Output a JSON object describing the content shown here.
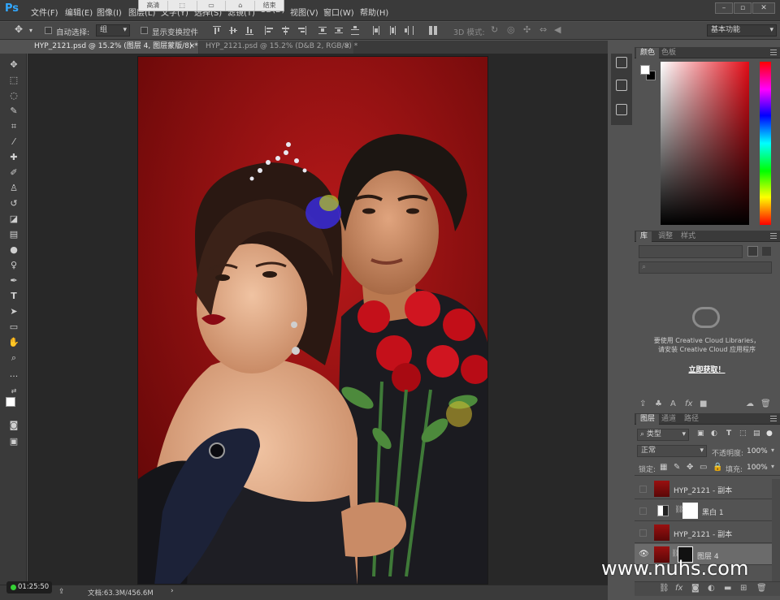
{
  "app": {
    "logo": "Ps",
    "menu": [
      "文件(F)",
      "编辑(E)",
      "图像(I)",
      "图层(L)",
      "文字(Y)",
      "选择(S)",
      "滤镜(T)",
      "3D(D)",
      "视图(V)",
      "窗口(W)",
      "帮助(H)"
    ],
    "overlay_buttons": [
      "高清",
      "",
      "",
      "",
      "结束"
    ]
  },
  "options": {
    "auto_select_label": "自动选择:",
    "auto_select_value": "组",
    "show_transform_label": "显示变换控件",
    "mode_3d_label": "3D 模式:",
    "workspace": "基本功能"
  },
  "tabs": [
    {
      "label": "HYP_2121.psd @ 15.2% (图层 4, 图层蒙版/8) *",
      "active": true
    },
    {
      "label": "HYP_2121.psd @ 15.2% (D&B 2, RGB/8) *",
      "active": false
    }
  ],
  "status": {
    "doc_size": "文档:63.3M/456.6M",
    "timer": "01:25:50"
  },
  "color_panel": {
    "tabs": [
      "颜色",
      "色板"
    ],
    "foreground": "#ffffff",
    "background": "#000000"
  },
  "libraries_panel": {
    "tabs": [
      "库",
      "调整",
      "样式"
    ],
    "message_line1": "要使用 Creative Cloud Libraries，",
    "message_line2": "请安装 Creative Cloud 应用程序",
    "link": "立即获取！"
  },
  "layers_panel": {
    "tabs": [
      "图层",
      "通道",
      "路径"
    ],
    "filter": "类型",
    "blend_mode": "正常",
    "opacity_label": "不透明度:",
    "opacity_value": "100%",
    "lock_label": "锁定:",
    "fill_label": "填充:",
    "fill_value": "100%",
    "layers": [
      {
        "name": "HYP_2121 - 副本",
        "type": "image",
        "visible": false,
        "selected": false
      },
      {
        "name": "黑白 1",
        "type": "adjustment",
        "visible": false,
        "selected": false
      },
      {
        "name": "HYP_2121 - 副本",
        "type": "image",
        "visible": false,
        "selected": false
      },
      {
        "name": "图层 4",
        "type": "masked",
        "visible": true,
        "selected": true
      }
    ]
  },
  "watermark": "www.nuhs.com"
}
